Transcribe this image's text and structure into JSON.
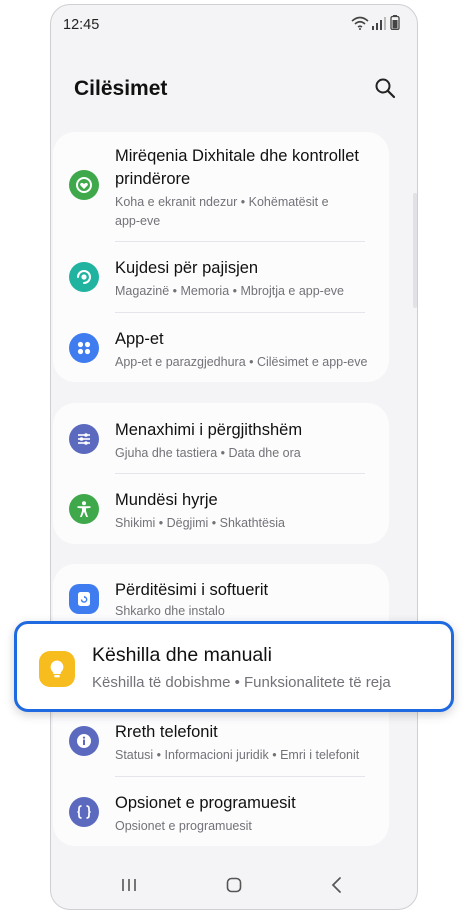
{
  "status_bar": {
    "time": "12:45"
  },
  "header": {
    "title": "Cilësimet"
  },
  "groups": [
    {
      "items": [
        {
          "title_line1": "Mirëqenia Dixhitale dhe kontrollet",
          "title_line2": "prindërore",
          "subtitle_line1": "Koha e ekranit ndezur  •  Kohëmatësit e",
          "subtitle_line2": "app-eve",
          "icon": "digital-wellbeing-icon",
          "color": "#3fa84b"
        },
        {
          "title": "Kujdesi për pajisjen",
          "subtitle": "Magazinë  •  Memoria  •  Mbrojtja e app-eve",
          "icon": "device-care-icon",
          "color": "#1fb3a0"
        },
        {
          "title": "App-et",
          "subtitle": "App-et e parazgjedhura  •  Cilësimet e app-eve",
          "icon": "apps-icon",
          "color": "#3f7cf0"
        }
      ]
    },
    {
      "items": [
        {
          "title": "Menaxhimi i përgjithshëm",
          "subtitle": "Gjuha dhe tastiera  •  Data dhe ora",
          "icon": "sliders-icon",
          "color": "#5b6abf"
        },
        {
          "title": "Mundësi hyrje",
          "subtitle": "Shikimi  •  Dëgjimi  •  Shkathtësia",
          "icon": "accessibility-icon",
          "color": "#3fa84b"
        }
      ]
    },
    {
      "items": [
        {
          "title": "Përditësimi i softuerit",
          "subtitle": "Shkarko dhe instalo",
          "icon": "software-update-icon",
          "color": "#3f7cf0"
        },
        {
          "title": "Këshilla dhe manuali",
          "subtitle": "Këshilla të dobishme  •  Funksionalitete të reja",
          "icon": "lightbulb-icon",
          "color": "#f7bc1d"
        },
        {
          "title": "Rreth telefonit",
          "subtitle": "Statusi  •  Informacioni juridik  •  Emri i telefonit",
          "icon": "info-icon",
          "color": "#5b6abf"
        },
        {
          "title": "Opsionet e programuesit",
          "subtitle": "Opsionet e programuesit",
          "icon": "developer-braces-icon",
          "color": "#5b6abf"
        }
      ]
    }
  ],
  "highlight_color": "#1f6ae0"
}
